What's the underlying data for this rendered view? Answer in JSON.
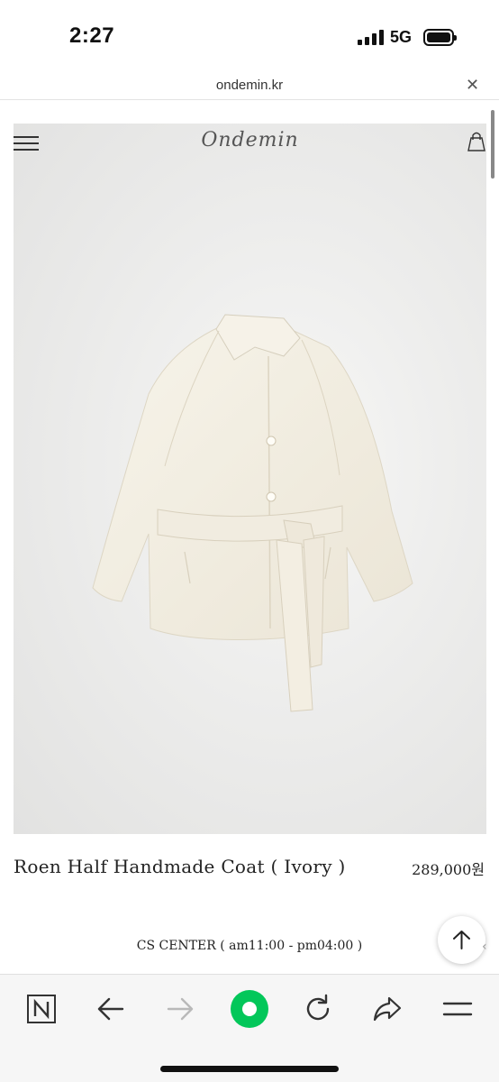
{
  "status_bar": {
    "time": "2:27",
    "network": "5G"
  },
  "browser": {
    "url": "ondemin.kr",
    "close_icon": "close-icon"
  },
  "site": {
    "logo": "Ondemin",
    "menu_icon": "hamburger-menu-icon",
    "cart_icon": "shopping-bag-icon"
  },
  "product": {
    "name": "Roen Half Handmade Coat ( Ivory )",
    "price": "289,000원",
    "image": "ivory belted half coat"
  },
  "footer": {
    "cs_center": "CS CENTER ( am11:00 - pm04:00 )"
  },
  "scroll_top_icon": "arrow-up-icon",
  "toolbar": {
    "items": [
      "naver-icon",
      "back-icon",
      "forward-icon",
      "green-circle-icon",
      "reload-icon",
      "share-icon",
      "menu-icon"
    ]
  },
  "colors": {
    "accent_green": "#03c75a",
    "coat_ivory": "#f3efe4",
    "background_gray": "#e8e8e7"
  }
}
